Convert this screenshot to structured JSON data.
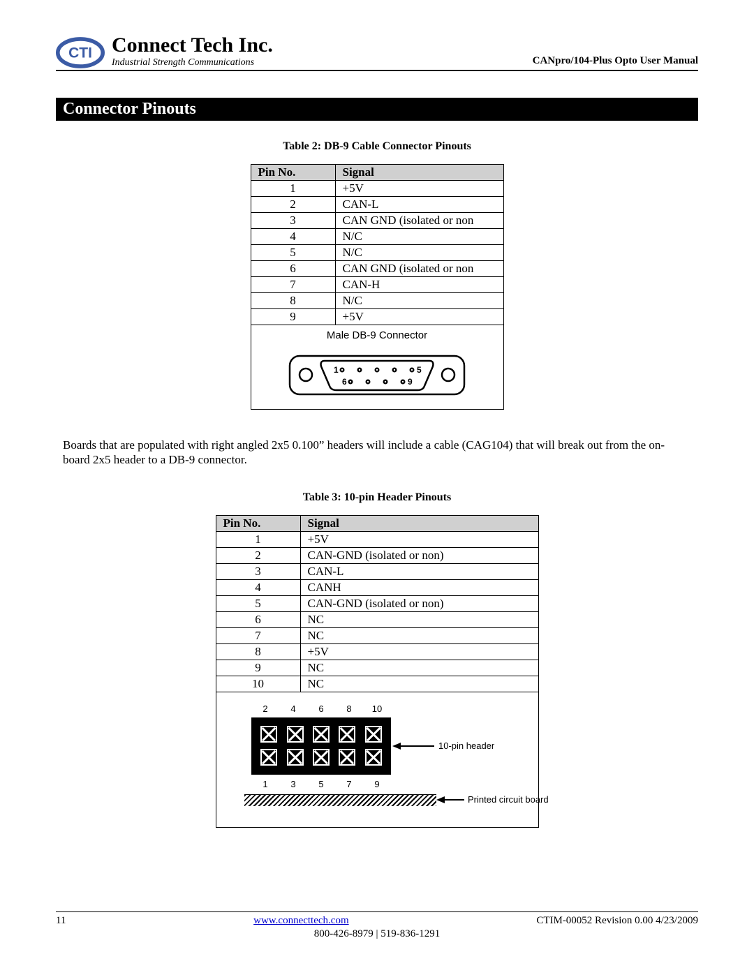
{
  "header": {
    "company": "Connect Tech Inc.",
    "tagline": "Industrial Strength Communications",
    "doc_title": "CANpro/104-Plus Opto User Manual"
  },
  "section_title": "Connector Pinouts",
  "table2": {
    "caption": "Table 2: DB-9 Cable Connector Pinouts",
    "headers": {
      "pin": "Pin No.",
      "signal": "Signal"
    },
    "rows": [
      {
        "pin": "1",
        "signal": "+5V"
      },
      {
        "pin": "2",
        "signal": "CAN-L"
      },
      {
        "pin": "3",
        "signal": "CAN GND (isolated or non"
      },
      {
        "pin": "4",
        "signal": "N/C"
      },
      {
        "pin": "5",
        "signal": "N/C"
      },
      {
        "pin": "6",
        "signal": "CAN GND (isolated or non"
      },
      {
        "pin": "7",
        "signal": "CAN-H"
      },
      {
        "pin": "8",
        "signal": "N/C"
      },
      {
        "pin": "9",
        "signal": "+5V"
      }
    ],
    "diagram": {
      "title": "Male DB-9 Connector",
      "pin_labels": {
        "tl": "1",
        "tr": "5",
        "bl": "6",
        "br": "9"
      }
    }
  },
  "body_paragraph": "Boards that are populated with right angled 2x5 0.100” headers will include a cable (CAG104) that will break out from the on-board 2x5 header to a DB-9 connector.",
  "table3": {
    "caption": "Table 3:  10-pin Header Pinouts",
    "headers": {
      "pin": "Pin No.",
      "signal": "Signal"
    },
    "rows": [
      {
        "pin": "1",
        "signal": "+5V"
      },
      {
        "pin": "2",
        "signal": "CAN-GND (isolated or non)"
      },
      {
        "pin": "3",
        "signal": "CAN-L"
      },
      {
        "pin": "4",
        "signal": "CANH"
      },
      {
        "pin": "5",
        "signal": "CAN-GND (isolated or non)"
      },
      {
        "pin": "6",
        "signal": "NC"
      },
      {
        "pin": "7",
        "signal": "NC"
      },
      {
        "pin": "8",
        "signal": "+5V"
      },
      {
        "pin": "9",
        "signal": "NC"
      },
      {
        "pin": "10",
        "signal": "NC"
      }
    ],
    "diagram": {
      "top_nums": [
        "2",
        "4",
        "6",
        "8",
        "10"
      ],
      "bot_nums": [
        "1",
        "3",
        "5",
        "7",
        "9"
      ],
      "label_header": "10-pin header",
      "label_pcb": "Printed circuit board"
    }
  },
  "footer": {
    "page_no": "11",
    "url_text": "www.connecttech.com",
    "revision": "CTIM-00052 Revision 0.00 4/23/2009",
    "phones": "800-426-8979 | 519-836-1291"
  }
}
